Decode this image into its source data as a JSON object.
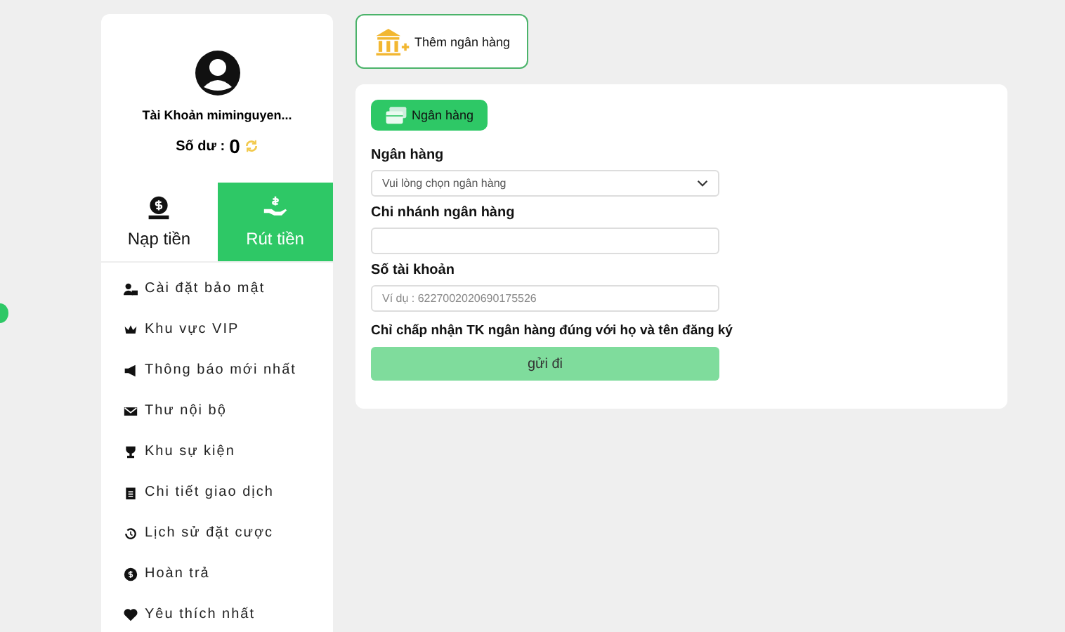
{
  "profile": {
    "account": "Tài Khoản miminguyen...",
    "balance_label": "Số dư :",
    "balance": "0"
  },
  "wallet_tabs": [
    {
      "label": "Nạp tiền",
      "kind": "deposit",
      "selected": false
    },
    {
      "label": "Rút tiền",
      "kind": "withdraw",
      "selected": true
    }
  ],
  "menu": [
    {
      "label": "Cài đặt bảo mật",
      "kind": "security"
    },
    {
      "label": "Khu vực VIP",
      "kind": "vip"
    },
    {
      "label": "Thông báo mới nhất",
      "kind": "notice"
    },
    {
      "label": "Thư nội bộ",
      "kind": "mail"
    },
    {
      "label": "Khu sự kiện",
      "kind": "event"
    },
    {
      "label": "Chi tiết giao dịch",
      "kind": "detail"
    },
    {
      "label": "Lịch sử đặt cược",
      "kind": "history"
    },
    {
      "label": "Hoàn trả",
      "kind": "refund"
    },
    {
      "label": "Yêu thích nhất",
      "kind": "favorite"
    }
  ],
  "add_bank_button": "Thêm ngân hàng",
  "bank_tab": "Ngân hàng",
  "form": {
    "fields": [
      {
        "label": "Ngân hàng",
        "kind": "select",
        "placeholder": "Vui lòng chọn ngân hàng"
      },
      {
        "label": "Chi nhánh ngân hàng",
        "kind": "text"
      },
      {
        "label": "Số tài khoản",
        "kind": "text",
        "placeholder": "Ví dụ : 6227002020690175526"
      }
    ],
    "note": "Chỉ chấp nhận TK ngân hàng đúng với họ và tên đăng ký",
    "submit": {
      "label": "gửi đi",
      "disabled": true
    }
  }
}
